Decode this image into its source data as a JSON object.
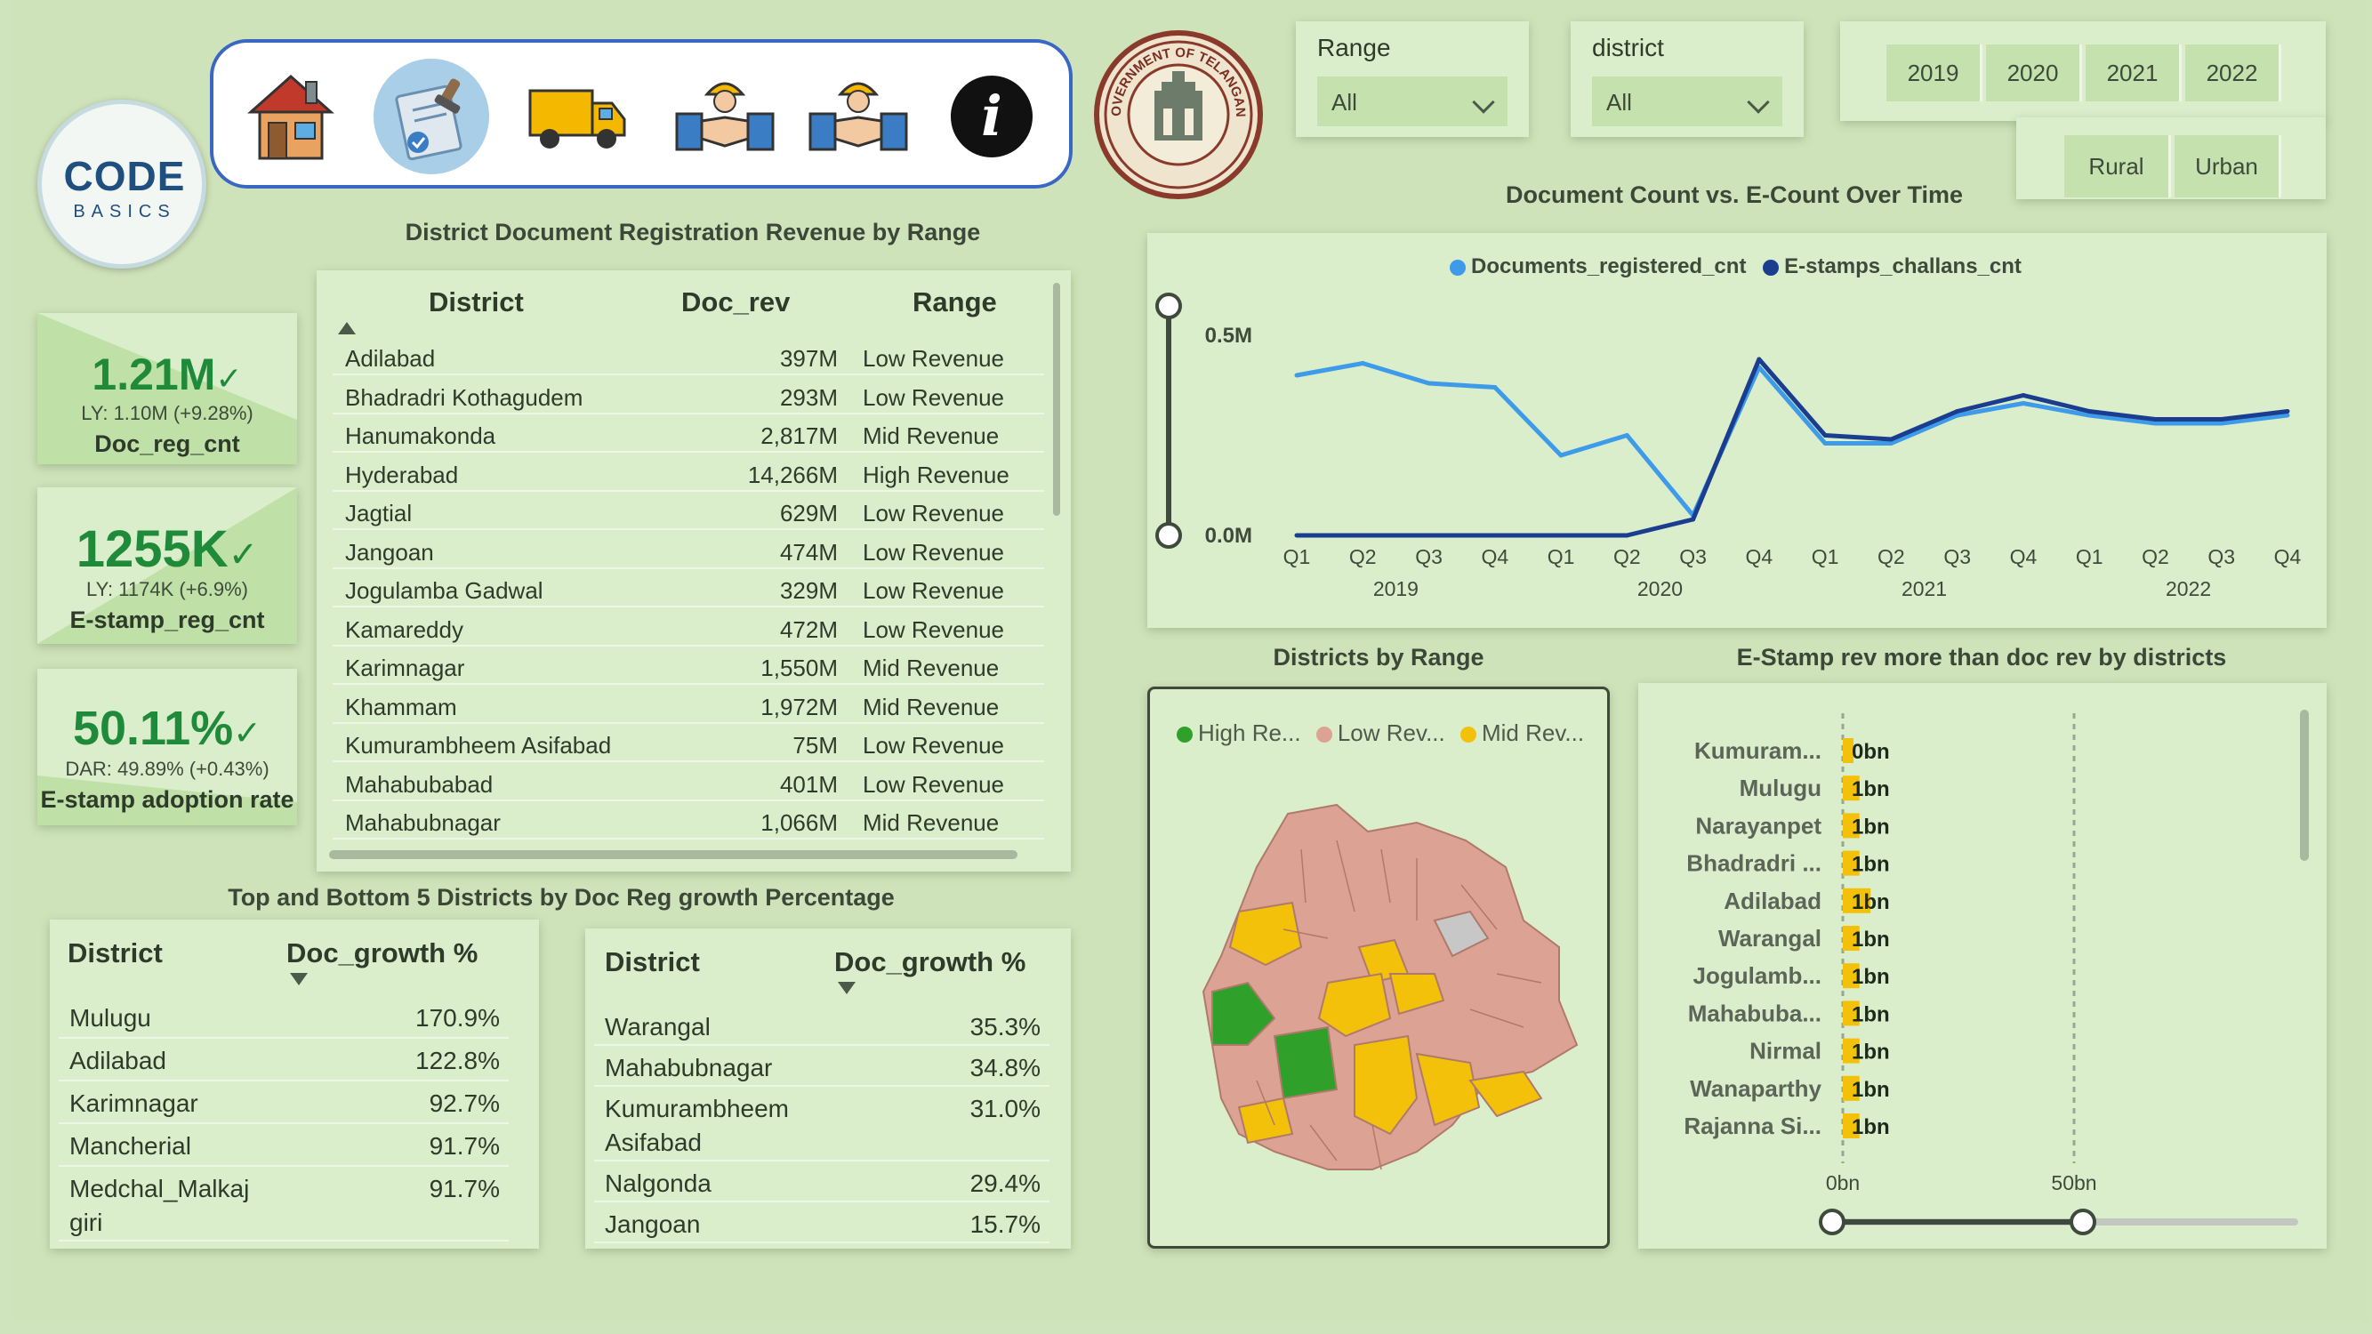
{
  "logo": {
    "main": "CODE",
    "sub": "BASICS"
  },
  "nav": {
    "icons": [
      "home-icon",
      "document-stamp-icon",
      "truck-icon",
      "handshake-icon",
      "handshake-icon",
      "info-icon"
    ],
    "info_glyph": "i"
  },
  "seal": {
    "label": "GOVERNMENT OF TELANGANA"
  },
  "slicers": {
    "range": {
      "label": "Range",
      "value": "All"
    },
    "district": {
      "label": "district",
      "value": "All"
    },
    "years": [
      "2019",
      "2020",
      "2021",
      "2022"
    ],
    "area": [
      "Rural",
      "Urban"
    ]
  },
  "kpis": [
    {
      "value": "1.21M",
      "check": "✓",
      "ly": "LY: 1.10M (+9.28%)",
      "name": "Doc_reg_cnt"
    },
    {
      "value": "1255K",
      "check": "✓",
      "ly": "LY: 1174K (+6.9%)",
      "name": "E-stamp_reg_cnt"
    },
    {
      "value": "50.11%",
      "check": "✓",
      "ly": "DAR: 49.89% (+0.43%)",
      "name": "E-stamp adoption rate"
    }
  ],
  "revenue_table": {
    "title": "District Document Registration Revenue by Range",
    "columns": [
      "District",
      "Doc_rev",
      "Range"
    ],
    "rows": [
      [
        "Adilabad",
        "397M",
        "Low Revenue"
      ],
      [
        "Bhadradri Kothagudem",
        "293M",
        "Low Revenue"
      ],
      [
        "Hanumakonda",
        "2,817M",
        "Mid Revenue"
      ],
      [
        "Hyderabad",
        "14,266M",
        "High Revenue"
      ],
      [
        "Jagtial",
        "629M",
        "Low Revenue"
      ],
      [
        "Jangoan",
        "474M",
        "Low Revenue"
      ],
      [
        "Jogulamba Gadwal",
        "329M",
        "Low Revenue"
      ],
      [
        "Kamareddy",
        "472M",
        "Low Revenue"
      ],
      [
        "Karimnagar",
        "1,550M",
        "Mid Revenue"
      ],
      [
        "Khammam",
        "1,972M",
        "Mid Revenue"
      ],
      [
        "Kumurambheem Asifabad",
        "75M",
        "Low Revenue"
      ],
      [
        "Mahabubabad",
        "401M",
        "Low Revenue"
      ],
      [
        "Mahabubnagar",
        "1,066M",
        "Mid Revenue"
      ]
    ]
  },
  "growth": {
    "title": "Top and Bottom 5 Districts by Doc Reg growth Percentage",
    "columns": [
      "District",
      "Doc_growth %"
    ],
    "top": [
      [
        "Mulugu",
        "170.9%"
      ],
      [
        "Adilabad",
        "122.8%"
      ],
      [
        "Karimnagar",
        "92.7%"
      ],
      [
        "Mancherial",
        "91.7%"
      ],
      [
        "Medchal_Malkaj giri",
        "91.7%"
      ]
    ],
    "bottom": [
      [
        "Warangal",
        "35.3%"
      ],
      [
        "Mahabubnagar",
        "34.8%"
      ],
      [
        "Kumurambheem Asifabad",
        "31.0%"
      ],
      [
        "Nalgonda",
        "29.4%"
      ],
      [
        "Jangoan",
        "15.7%"
      ]
    ]
  },
  "colors": {
    "docs": "#3d9be9",
    "estamps": "#1a3d8f",
    "high": "#2fa02a",
    "low": "#dca394",
    "mid": "#f3c10a",
    "gray": "#c7c7c7"
  },
  "chart_data": [
    {
      "type": "line",
      "title": "Document Count vs. E-Count Over Time",
      "categories": [
        "Q1",
        "Q2",
        "Q3",
        "Q4",
        "Q1",
        "Q2",
        "Q3",
        "Q4",
        "Q1",
        "Q2",
        "Q3",
        "Q4",
        "Q1",
        "Q2",
        "Q3",
        "Q4"
      ],
      "years": [
        "2019",
        "2020",
        "2021",
        "2022"
      ],
      "y_ticks": [
        "0.5M",
        "0.0M"
      ],
      "ylim": [
        0,
        0.6
      ],
      "legend_position": "top",
      "series": [
        {
          "name": "Documents_registered_cnt",
          "values": [
            0.4,
            0.43,
            0.38,
            0.37,
            0.2,
            0.25,
            0.05,
            0.42,
            0.23,
            0.23,
            0.3,
            0.33,
            0.3,
            0.28,
            0.28,
            0.3
          ]
        },
        {
          "name": "E-stamps_challans_cnt",
          "values": [
            0.0,
            0.0,
            0.0,
            0.0,
            0.0,
            0.0,
            0.04,
            0.44,
            0.25,
            0.24,
            0.31,
            0.35,
            0.31,
            0.29,
            0.29,
            0.31
          ]
        }
      ]
    },
    {
      "type": "bar",
      "title": "E-Stamp rev more than doc rev by districts",
      "categories": [
        "Kumuram...",
        "Mulugu",
        "Narayanpet",
        "Bhadradri ...",
        "Adilabad",
        "Warangal",
        "Jogulamb...",
        "Mahabuba...",
        "Nirmal",
        "Wanaparthy",
        "Rajanna Si..."
      ],
      "values": [
        0.02,
        0.3,
        0.3,
        0.3,
        0.5,
        0.3,
        0.3,
        0.3,
        0.3,
        0.3,
        0.3
      ],
      "data_labels": [
        "0bn",
        "1bn",
        "1bn",
        "1bn",
        "1bn",
        "1bn",
        "1bn",
        "1bn",
        "1bn",
        "1bn",
        "1bn"
      ],
      "x_ticks": [
        "0bn",
        "50bn"
      ],
      "xlim": [
        0,
        50
      ]
    },
    {
      "type": "map",
      "title": "Districts by Range",
      "legend": [
        "High Re...",
        "Low Rev...",
        "Mid Rev..."
      ]
    }
  ]
}
